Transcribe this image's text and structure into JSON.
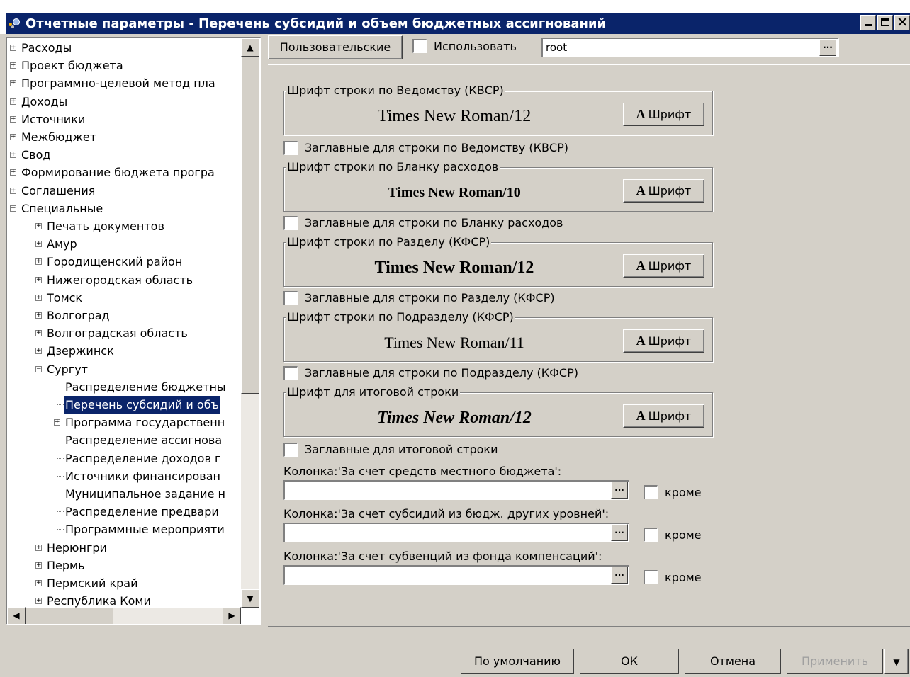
{
  "window": {
    "title": "Отчетные параметры - Перечень субсидий  и объем бюджетных ассигнований"
  },
  "tree": {
    "items": [
      {
        "label": "Расходы",
        "level": 0,
        "expander": "+"
      },
      {
        "label": "Проект бюджета",
        "level": 0,
        "expander": "+"
      },
      {
        "label": "Программно-целевой метод пла",
        "level": 0,
        "expander": "+"
      },
      {
        "label": "Доходы",
        "level": 0,
        "expander": "+"
      },
      {
        "label": "Источники",
        "level": 0,
        "expander": "+"
      },
      {
        "label": "Межбюджет",
        "level": 0,
        "expander": "+"
      },
      {
        "label": "Свод",
        "level": 0,
        "expander": "+"
      },
      {
        "label": "Формирование бюджета програ",
        "level": 0,
        "expander": "+"
      },
      {
        "label": "Соглашения",
        "level": 0,
        "expander": "+"
      },
      {
        "label": "Специальные",
        "level": 0,
        "expander": "-"
      },
      {
        "label": "Печать документов",
        "level": 1,
        "expander": "+"
      },
      {
        "label": "Амур",
        "level": 1,
        "expander": "+"
      },
      {
        "label": "Городищенский район",
        "level": 1,
        "expander": "+"
      },
      {
        "label": "Нижегородская область",
        "level": 1,
        "expander": "+"
      },
      {
        "label": "Томск",
        "level": 1,
        "expander": "+"
      },
      {
        "label": "Волгоград",
        "level": 1,
        "expander": "+"
      },
      {
        "label": "Волгоградская область",
        "level": 1,
        "expander": "+"
      },
      {
        "label": "Дзержинск",
        "level": 1,
        "expander": "+"
      },
      {
        "label": "Сургут",
        "level": 1,
        "expander": "-"
      },
      {
        "label": "Распределение бюджетны",
        "level": 2,
        "expander": ""
      },
      {
        "label": "Перечень субсидий  и объ",
        "level": 2,
        "expander": "",
        "selected": true
      },
      {
        "label": "Программа государственн",
        "level": 2,
        "expander": "+"
      },
      {
        "label": "Распределение ассигнова",
        "level": 2,
        "expander": ""
      },
      {
        "label": "Распределение доходов г",
        "level": 2,
        "expander": ""
      },
      {
        "label": "Источники финансирован",
        "level": 2,
        "expander": ""
      },
      {
        "label": "Муниципальное задание н",
        "level": 2,
        "expander": ""
      },
      {
        "label": "Распределение предвари",
        "level": 2,
        "expander": ""
      },
      {
        "label": "Программные мероприяти",
        "level": 2,
        "expander": ""
      },
      {
        "label": "Нерюнгри",
        "level": 1,
        "expander": "+"
      },
      {
        "label": "Пермь",
        "level": 1,
        "expander": "+"
      },
      {
        "label": "Пермский край",
        "level": 1,
        "expander": "+"
      },
      {
        "label": "Республика Коми",
        "level": 1,
        "expander": "+"
      }
    ]
  },
  "toolbar": {
    "user_settings_label": "Пользовательские",
    "use_label": "Использовать",
    "user_value": "root",
    "ellipsis": "..."
  },
  "font_groups": [
    {
      "legend": "Шрифт строки по Ведомству (КВСР)",
      "font_name": "Times New Roman/12",
      "button": "Шрифт",
      "caps_label": "Заглавные для строки по Ведомству (КВСР)"
    },
    {
      "legend": "Шрифт строки по Бланку расходов",
      "font_name": "Times New Roman/10",
      "button": "Шрифт",
      "caps_label": "Заглавные для строки по Бланку расходов"
    },
    {
      "legend": "Шрифт строки по Разделу (КФСР)",
      "font_name": "Times New Roman/12",
      "button": "Шрифт",
      "caps_label": "Заглавные для строки по Разделу (КФСР)"
    },
    {
      "legend": "Шрифт строки по Подразделу (КФСР)",
      "font_name": "Times New Roman/11",
      "button": "Шрифт",
      "caps_label": "Заглавные для строки по Подразделу (КФСР)"
    },
    {
      "legend": "Шрифт для итоговой строки",
      "font_name": "Times New Roman/12",
      "button": "Шрифт",
      "caps_label": "Заглавные для итоговой строки"
    }
  ],
  "columns": [
    {
      "label": "Колонка:'За счет средств местного бюджета':",
      "value": "",
      "except_label": "кроме"
    },
    {
      "label": "Колонка:'За счет субсидий из бюдж. других уровней':",
      "value": "",
      "except_label": "кроме"
    },
    {
      "label": "Колонка:'За счет субвенций из фонда компенсаций':",
      "value": "",
      "except_label": "кроме"
    }
  ],
  "footer": {
    "default_label": "По умолчанию",
    "ok_label": "ОК",
    "cancel_label": "Отмена",
    "apply_label": "Применить"
  },
  "colors": {
    "titlebar": "#0a246a",
    "face": "#d4d0c8",
    "selection": "#0a246a"
  }
}
